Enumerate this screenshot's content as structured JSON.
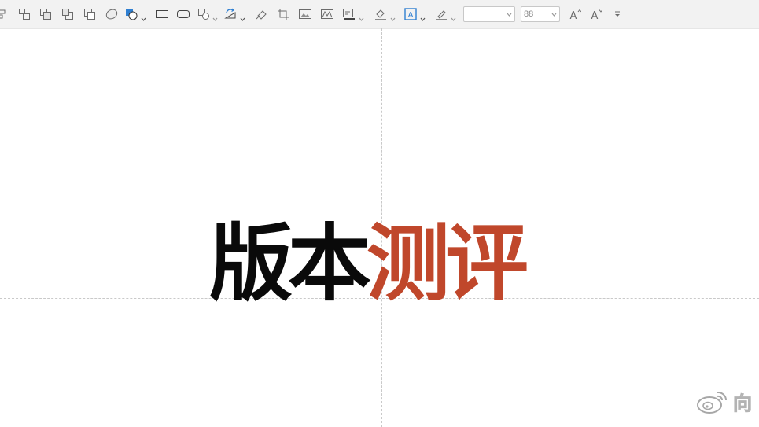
{
  "toolbar": {
    "font_family_value": "",
    "font_size_value": "88",
    "icons": [
      "align-icon",
      "group-icon",
      "bring-forward-icon",
      "send-backward-icon",
      "arrange-icon",
      "ellipse-icon",
      "shape-fill-icon",
      "rectangle-icon",
      "rounded-rectangle-icon",
      "shapes-icon",
      "rotate-icon",
      "format-painter-icon",
      "crop-icon",
      "picture-icon",
      "picture-adjust-icon",
      "text-edit-icon",
      "fill-color-icon",
      "text-box-icon",
      "font-color-icon",
      "increase-font-size-icon",
      "decrease-font-size-icon",
      "more-options-icon"
    ]
  },
  "canvas": {
    "headline_black": "版本",
    "headline_red": "测评",
    "headline_black_color": "#0a0a0a",
    "headline_red_color": "#c0472b"
  },
  "watermark": {
    "logo_icon": "weibo-logo-icon",
    "text": "向"
  }
}
